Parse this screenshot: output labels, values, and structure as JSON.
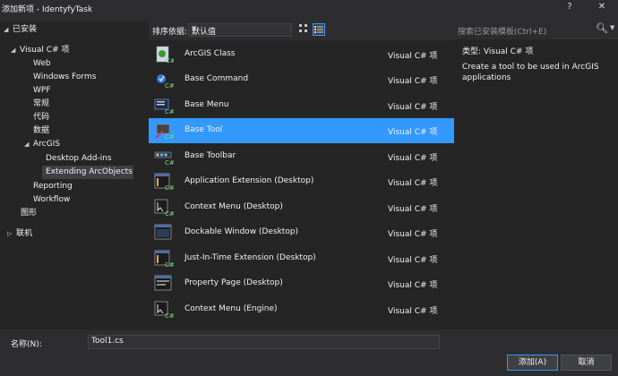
{
  "window": {
    "title": "添加新项 - IdentyfyTask",
    "help_glyph": "?",
    "close_glyph": "✕"
  },
  "tree": {
    "installed": "已安装",
    "visual_cs": "Visual C# 项",
    "web": "Web",
    "windows_forms": "Windows Forms",
    "wpf": "WPF",
    "general": "常规",
    "code": "代码",
    "data": "数据",
    "arcgis": "ArcGIS",
    "desktop_addins": "Desktop Add-ins",
    "extending_arcobjects": "Extending ArcObjects",
    "reporting": "Reporting",
    "workflow": "Workflow",
    "graphics": "图形",
    "online": "联机"
  },
  "toolbar": {
    "sort_label": "排序依据:",
    "sort_value": "默认值"
  },
  "templates": [
    {
      "name": "ArcGIS Class",
      "lang": "Visual C# 项",
      "icon": "arcgis-class-icon"
    },
    {
      "name": "Base Command",
      "lang": "Visual C# 项",
      "icon": "base-command-icon"
    },
    {
      "name": "Base Menu",
      "lang": "Visual C# 项",
      "icon": "base-menu-icon"
    },
    {
      "name": "Base Tool",
      "lang": "Visual C# 项",
      "icon": "base-tool-icon"
    },
    {
      "name": "Base Toolbar",
      "lang": "Visual C# 项",
      "icon": "base-toolbar-icon"
    },
    {
      "name": "Application Extension (Desktop)",
      "lang": "Visual C# 项",
      "icon": "application-extension-icon"
    },
    {
      "name": "Context Menu (Desktop)",
      "lang": "Visual C# 项",
      "icon": "context-menu-icon"
    },
    {
      "name": "Dockable Window (Desktop)",
      "lang": "Visual C# 项",
      "icon": "dockable-window-icon"
    },
    {
      "name": "Just-In-Time Extension (Desktop)",
      "lang": "Visual C# 项",
      "icon": "jit-extension-icon"
    },
    {
      "name": "Property Page (Desktop)",
      "lang": "Visual C# 项",
      "icon": "property-page-icon"
    },
    {
      "name": "Context Menu (Engine)",
      "lang": "Visual C# 项",
      "icon": "context-menu-engine-icon"
    }
  ],
  "search": {
    "placeholder": "搜索已安装模板(Ctrl+E)"
  },
  "details": {
    "type_label": "类型:",
    "type_value": "Visual C# 项",
    "description": "Create a tool to be used in ArcGIS applications"
  },
  "bottom": {
    "name_label": "名称(N):",
    "name_value": "Tool1.cs",
    "add_button": "添加(A)",
    "cancel_button": "取消"
  },
  "colors": {
    "accent": "#3399ff",
    "background": "#2d2d30",
    "panel": "#252526"
  }
}
